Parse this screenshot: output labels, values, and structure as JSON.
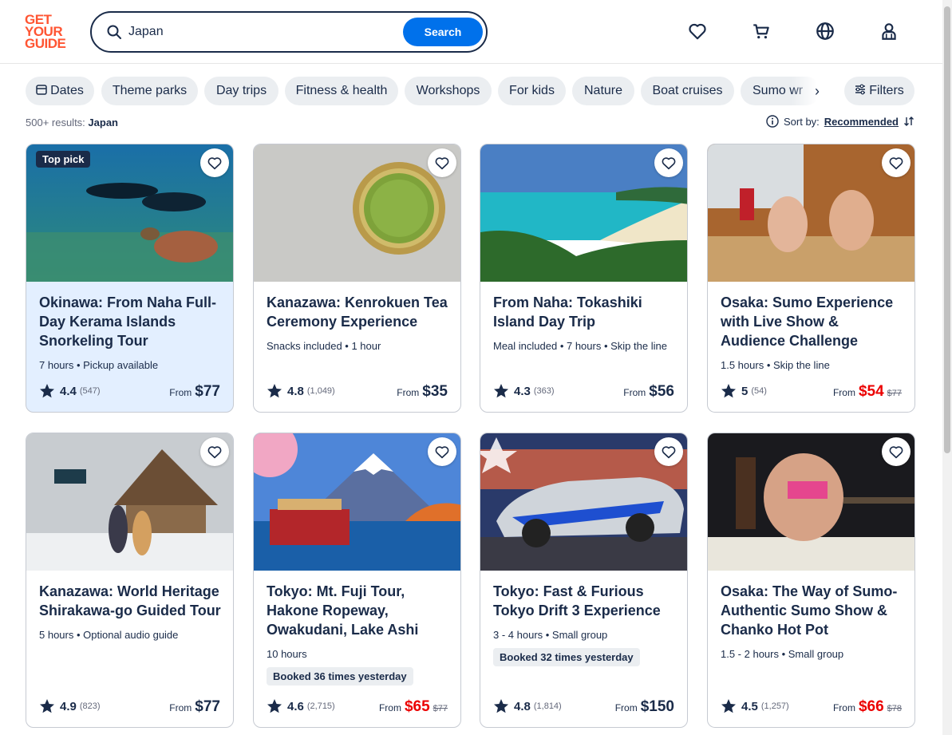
{
  "brand": {
    "logo_lines": [
      "GET",
      "YOUR",
      "GUIDE"
    ],
    "accent": "#ff5533",
    "primary": "#0071eb",
    "ink": "#1a2b49"
  },
  "search": {
    "value": "Japan",
    "button": "Search"
  },
  "header_icons": [
    "heart-icon",
    "cart-icon",
    "globe-icon",
    "profile-icon"
  ],
  "chips": [
    "Dates",
    "Theme parks",
    "Day trips",
    "Fitness & health",
    "Workshops",
    "For kids",
    "Nature",
    "Boat cruises",
    "Sumo wr"
  ],
  "filters_label": "Filters",
  "results": {
    "count": "500+ results:",
    "query": "Japan"
  },
  "sort": {
    "label": "Sort by:",
    "value": "Recommended"
  },
  "cards": [
    {
      "badge": "Top pick",
      "title": "Okinawa: From Naha Full-Day Kerama Islands Snorkeling Tour",
      "meta": "7 hours • Pickup available",
      "rating": "4.4",
      "reviews": "(547)",
      "from": "From",
      "price": "$77",
      "was": ""
    },
    {
      "title": "Kanazawa: Kenrokuen Tea Ceremony Experience",
      "meta": "Snacks included • 1 hour",
      "rating": "4.8",
      "reviews": "(1,049)",
      "from": "From",
      "price": "$35",
      "was": ""
    },
    {
      "title": "From Naha: Tokashiki Island Day Trip",
      "meta": "Meal included • 7 hours • Skip the line",
      "rating": "4.3",
      "reviews": "(363)",
      "from": "From",
      "price": "$56",
      "was": ""
    },
    {
      "title": "Osaka: Sumo Experience with Live Show & Audience Challenge",
      "meta": "1.5 hours • Skip the line",
      "rating": "5",
      "reviews": "(54)",
      "from": "From",
      "price": "$54",
      "was": "$77"
    },
    {
      "title": "Kanazawa: World Heritage Shirakawa-go Guided Tour",
      "meta": "5 hours • Optional audio guide",
      "rating": "4.9",
      "reviews": "(823)",
      "from": "From",
      "price": "$77",
      "was": ""
    },
    {
      "title": "Tokyo: Mt. Fuji Tour, Hakone Ropeway, Owakudani, Lake Ashi",
      "meta": "10 hours",
      "booked": "Booked 36 times yesterday",
      "rating": "4.6",
      "reviews": "(2,715)",
      "from": "From",
      "price": "$65",
      "was": "$77"
    },
    {
      "title": "Tokyo: Fast & Furious Tokyo Drift 3 Experience",
      "meta": "3 - 4 hours • Small group",
      "booked": "Booked 32 times yesterday",
      "rating": "4.8",
      "reviews": "(1,814)",
      "from": "From",
      "price": "$150",
      "was": ""
    },
    {
      "title": "Osaka: The Way of Sumo-Authentic Sumo Show & Chanko Hot Pot",
      "meta": "1.5 - 2 hours • Small group",
      "rating": "4.5",
      "reviews": "(1,257)",
      "from": "From",
      "price": "$66",
      "was": "$78"
    }
  ]
}
